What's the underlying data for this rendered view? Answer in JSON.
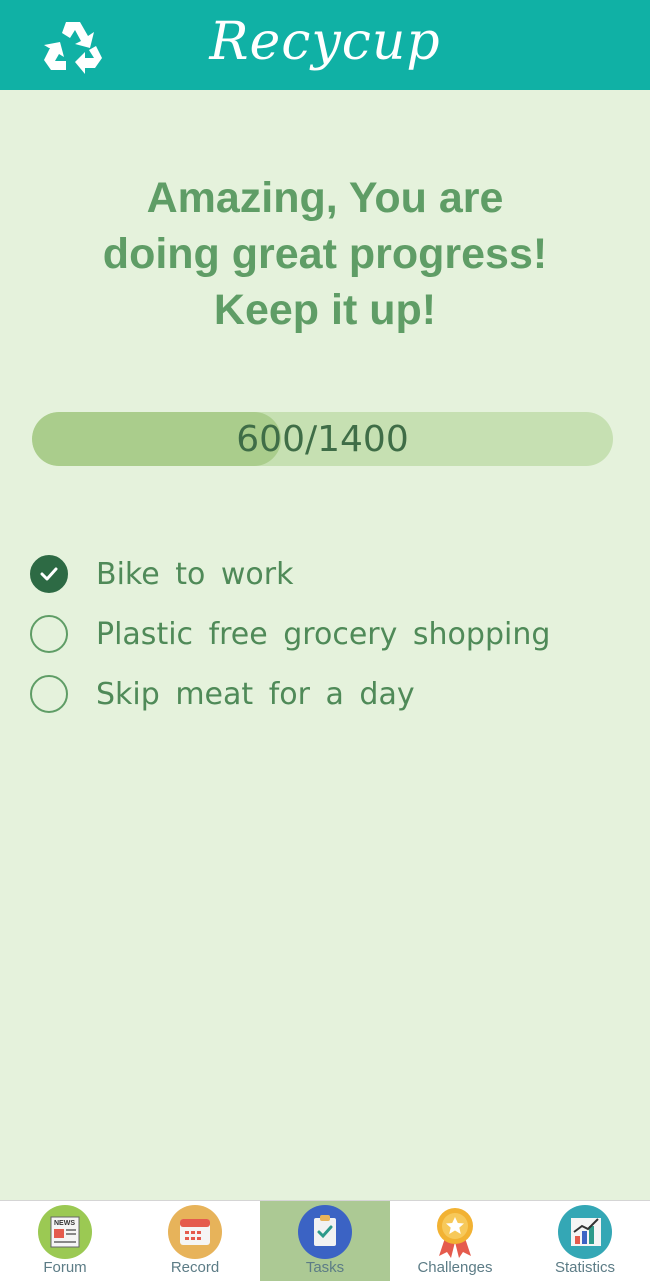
{
  "app": {
    "brand": "Recycup",
    "logo_icon": "recycle-icon"
  },
  "colors": {
    "header": "#10b1a5",
    "background": "#e5f2dc",
    "message": "#5f9d66",
    "progress_track": "#c6e0b2",
    "progress_fill": "#aacd8c",
    "active_tab": "#acc994"
  },
  "message": {
    "line1": "Amazing, You are",
    "line2": "doing great progress!",
    "line3": "Keep it up!"
  },
  "progress": {
    "current": 600,
    "total": 1400,
    "label": "600/1400"
  },
  "tasks": [
    {
      "label": "Bike to work",
      "done": true
    },
    {
      "label": "Plastic free grocery shopping",
      "done": false
    },
    {
      "label": "Skip meat for a day",
      "done": false
    }
  ],
  "nav": [
    {
      "label": "Forum",
      "icon": "newspaper-icon",
      "active": false
    },
    {
      "label": "Record",
      "icon": "calendar-icon",
      "active": false
    },
    {
      "label": "Tasks",
      "icon": "clipboard-check-icon",
      "active": true
    },
    {
      "label": "Challenges",
      "icon": "medal-star-icon",
      "active": false
    },
    {
      "label": "Statistics",
      "icon": "bar-chart-icon",
      "active": false
    }
  ]
}
